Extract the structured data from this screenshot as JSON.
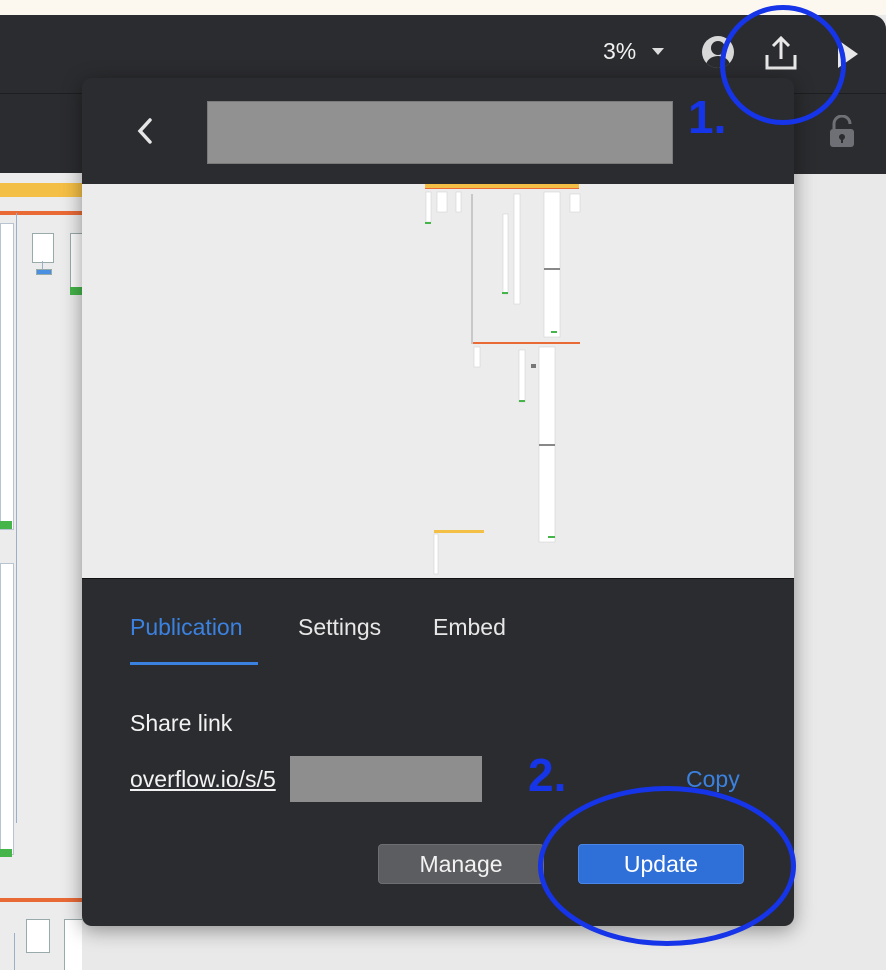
{
  "toolbar": {
    "zoom_level": "3%",
    "zoom_caret": "chevron-down-icon",
    "avatar_icon": "user-avatar-icon",
    "share_icon": "share-upload-icon",
    "play_icon": "play-icon",
    "lock_icon": "lock-open-icon"
  },
  "share_panel": {
    "back_icon": "chevron-left-icon",
    "tabs": [
      {
        "label": "Publication",
        "active": true
      },
      {
        "label": "Settings",
        "active": false
      },
      {
        "label": "Embed",
        "active": false
      }
    ],
    "share_link_label": "Share link",
    "share_link_visible": "overflow.io/s/5",
    "copy_label": "Copy",
    "manage_label": "Manage",
    "update_label": "Update"
  },
  "annotations": {
    "step1": "1.",
    "step2": "2."
  },
  "colors": {
    "accent": "#3b82e0",
    "annotation": "#1634e8",
    "panel_bg": "#2b2c2f"
  }
}
